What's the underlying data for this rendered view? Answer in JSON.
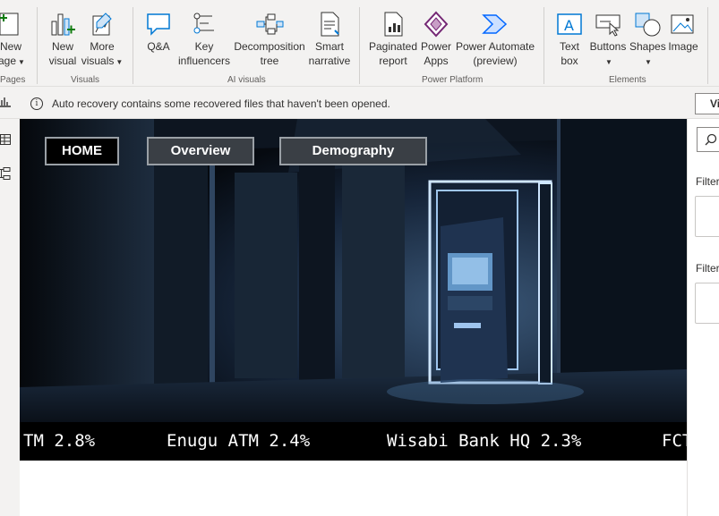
{
  "ribbon": {
    "pages": {
      "new_page_line1": "New",
      "new_page_line2": "age",
      "group": "Pages"
    },
    "visuals": {
      "new_visual_line1": "New",
      "new_visual_line2": "visual",
      "more_visuals_line1": "More",
      "more_visuals_line2": "visuals",
      "group": "Visuals"
    },
    "ai_visuals": {
      "qa": "Q&A",
      "key_influencers_line1": "Key",
      "key_influencers_line2": "influencers",
      "decomposition_line1": "Decomposition",
      "decomposition_line2": "tree",
      "smart_narrative_line1": "Smart",
      "smart_narrative_line2": "narrative",
      "group": "AI visuals"
    },
    "power_platform": {
      "paginated_line1": "Paginated",
      "paginated_line2": "report",
      "power_apps_line1": "Power",
      "power_apps_line2": "Apps",
      "power_automate_line1": "Power Automate",
      "power_automate_line2": "(preview)",
      "group": "Power Platform"
    },
    "elements": {
      "text_box_line1": "Text",
      "text_box_line2": "box",
      "buttons": "Buttons",
      "shapes": "Shapes",
      "image": "Image",
      "group": "Elements"
    },
    "colors": {
      "accent": "#0078d4",
      "powerapps": "#742774",
      "automate": "#0066ff",
      "green": "#107c10"
    }
  },
  "infobar": {
    "message": "Auto recovery contains some recovered files that haven't been opened.",
    "view_button": "Vi"
  },
  "report": {
    "nav": {
      "home": "HOME",
      "overview": "Overview",
      "demography": "Demography"
    },
    "ticker": [
      "TM 2.8%",
      "Enugu ATM 2.4%",
      "Wisabi Bank HQ 2.3%",
      "FCT"
    ]
  },
  "filters_pane": {
    "filter_label_1": "Filter",
    "filter_label_2": "Filter"
  }
}
